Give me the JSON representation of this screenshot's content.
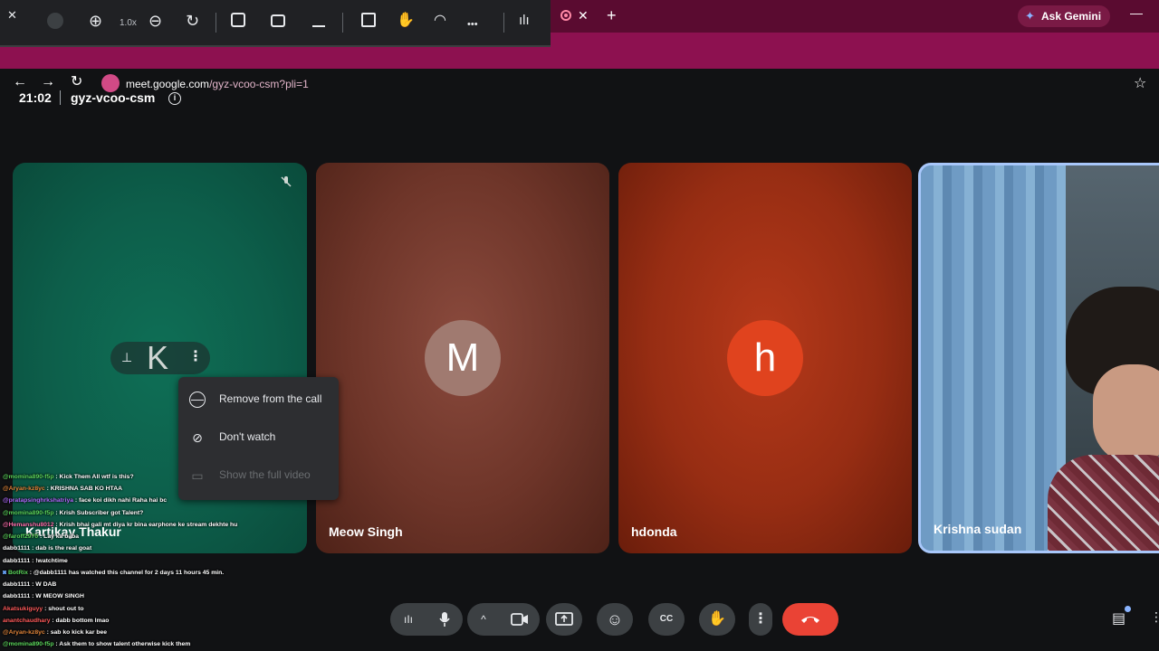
{
  "browser": {
    "new_tab": "+",
    "tab_close": "✕",
    "ask_gemini": "Ask Gemini",
    "gemini_icon": "✦",
    "minimize": "—",
    "url_host": "meet.google.com",
    "url_path": "/gyz-vcoo-csm?pli=1",
    "back": "←",
    "forward": "→",
    "reload": "↻",
    "bookmark": "☆"
  },
  "viewer_toolbar": {
    "close": "✕",
    "zoom_in": "⊕",
    "zoom_level": "1.0x",
    "zoom_out": "⊖",
    "rotate": "↻",
    "more": "•••"
  },
  "meeting": {
    "time": "21:02",
    "code": "gyz-vcoo-csm",
    "info_icon": "i"
  },
  "tiles": [
    {
      "name": "Kartikay Thakur",
      "letter": "K"
    },
    {
      "name": "Meow Singh",
      "letter": "M"
    },
    {
      "name": "hdonda",
      "letter": "h"
    },
    {
      "name": "Krishna sudan"
    }
  ],
  "hover_controls": {
    "pin": "⊥",
    "letter": "K",
    "more": "⋮"
  },
  "context_menu": [
    {
      "label": "Remove from the call",
      "icon": "—",
      "disabled": false
    },
    {
      "label": "Don't watch",
      "icon": "⊘",
      "disabled": false
    },
    {
      "label": "Show the full video",
      "icon": "▭",
      "disabled": true
    }
  ],
  "chat": [
    {
      "user": "@momina890-f5p",
      "text": ": Kick Them All wtf is this?",
      "color": "green"
    },
    {
      "user": "@Aryan-kz8yc",
      "text": ": KRISHNA SAB KO HTAA",
      "color": "orange"
    },
    {
      "user": "@pratapsinghrkshatriya",
      "text": ": face koi dikh nahi Raha hai bc",
      "color": "purple"
    },
    {
      "user": "@momina890-f5p",
      "text": ": Krish Subscriber got Talent?",
      "color": "green"
    },
    {
      "user": "@Hemanshu8012",
      "text": ": Krish bhai gali mt diya kr bina earphone ke stream dekhte hu",
      "color": "pink"
    },
    {
      "user": "@faroff2970",
      "text": ": Lay ka baba",
      "color": "green"
    },
    {
      "user": "dabb1111",
      "text": ": dab is the real goat",
      "color": "white"
    },
    {
      "user": "dabb1111",
      "text": ": !watchtime",
      "color": "white"
    },
    {
      "user": "BotRix",
      "text": ": @dabb1111 has watched this channel for 2 days 11 hours 45 min.",
      "color": "green"
    },
    {
      "user": "dabb1111",
      "text": ": W DAB",
      "color": "white"
    },
    {
      "user": "dabb1111",
      "text": ": W MEOW SINGH",
      "color": "white"
    },
    {
      "user": "Akatsukiguyy",
      "text": ": shout out to",
      "color": "red"
    },
    {
      "user": "anantchaudhary",
      "text": ": dabb bottom lmao",
      "color": "red"
    },
    {
      "user": "@Aryan-kz8yc",
      "text": ": sab ko kick kar bee",
      "color": "orange"
    },
    {
      "user": "@momina890-f5p",
      "text": ": Ask them to show talent otherwise kick them",
      "color": "green"
    }
  ],
  "controls": {
    "audio_levels": "ıIı",
    "mic": "🎙",
    "chevron": "^",
    "camera": "▭",
    "present": "⇪",
    "emoji": "☺",
    "captions": "CC",
    "raise_hand": "✋",
    "more": "⋮",
    "end_call": "☎",
    "chat": "▤",
    "right_more": "⋮"
  },
  "colors": {
    "chrome_tabstrip": "#5a0b30",
    "chrome_addrbar": "#8d1150",
    "end_call": "#ea4335",
    "active_speaker_border": "#a8c7fa"
  }
}
